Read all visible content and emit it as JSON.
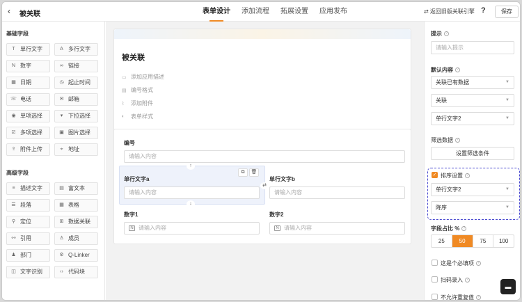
{
  "header": {
    "back_icon": "chevron-left-icon",
    "title": "被关联",
    "tabs": [
      {
        "label": "表单设计",
        "active": true
      },
      {
        "label": "添加流程",
        "active": false
      },
      {
        "label": "拓展设置",
        "active": false
      },
      {
        "label": "应用发布",
        "active": false
      }
    ],
    "engine_label": "⇄ 返回旧版关联引擎",
    "help": "?",
    "save_label": "保存"
  },
  "palette": {
    "basic_title": "基础字段",
    "basic": [
      {
        "icon": "T",
        "label": "单行文字"
      },
      {
        "icon": "A",
        "label": "多行文字"
      },
      {
        "icon": "N",
        "label": "数字"
      },
      {
        "icon": "∞",
        "label": "链接"
      },
      {
        "icon": "▦",
        "label": "日期"
      },
      {
        "icon": "◷",
        "label": "起止时间"
      },
      {
        "icon": "☏",
        "label": "电话"
      },
      {
        "icon": "✉",
        "label": "邮箱"
      },
      {
        "icon": "◉",
        "label": "单项选择"
      },
      {
        "icon": "▾",
        "label": "下拉选择"
      },
      {
        "icon": "☑",
        "label": "多项选择"
      },
      {
        "icon": "▣",
        "label": "图片选择"
      },
      {
        "icon": "⇪",
        "label": "附件上传"
      },
      {
        "icon": "⌖",
        "label": "地址"
      }
    ],
    "advanced_title": "高级字段",
    "advanced": [
      {
        "icon": "≡",
        "label": "描述文字"
      },
      {
        "icon": "▤",
        "label": "富文本"
      },
      {
        "icon": "☰",
        "label": "段落"
      },
      {
        "icon": "▦",
        "label": "表格"
      },
      {
        "icon": "⚲",
        "label": "定位"
      },
      {
        "icon": "⊞",
        "label": "数据关联"
      },
      {
        "icon": "⚯",
        "label": "引用"
      },
      {
        "icon": "♙",
        "label": "成员"
      },
      {
        "icon": "♟",
        "label": "部门"
      },
      {
        "icon": "⚙",
        "label": "Q-Linker"
      },
      {
        "icon": "◫",
        "label": "文字识别"
      },
      {
        "icon": "‹›",
        "label": "代码块"
      }
    ]
  },
  "form": {
    "title": "被关联",
    "meta": [
      {
        "icon": "▭",
        "label": "添加应用描述"
      },
      {
        "icon": "▤",
        "label": "编号格式"
      },
      {
        "icon": "⌇",
        "label": "添加附件"
      },
      {
        "icon": "◐",
        "label": "表单样式"
      }
    ],
    "fields": {
      "number_label": "编号",
      "number_placeholder": "请输入内容",
      "a_label": "单行文字a",
      "a_placeholder": "请输入内容",
      "b_label": "单行文字b",
      "b_placeholder": "请输入内容",
      "n1_label": "数字1",
      "n1_placeholder": "请输入内容",
      "n2_label": "数字2",
      "n2_placeholder": "请输入内容",
      "number_icon_text": "N"
    }
  },
  "props": {
    "hint_label": "提示",
    "hint_placeholder": "请输入提示",
    "default_label": "默认内容",
    "default_select": "关联已有数据",
    "relation_select": "关联",
    "field_select": "单行文字2",
    "filter_label": "筛选数据",
    "filter_button": "设置筛选条件",
    "sort_label": "排序设置",
    "sort_field": "单行文字2",
    "sort_order": "降序",
    "ratio_label": "字段占比 %",
    "ratio_options": [
      "25",
      "50",
      "75",
      "100"
    ],
    "ratio_selected": "50",
    "required_label": "这是个必填项",
    "scan_label": "扫码录入",
    "unique_label": "不允许重复值"
  },
  "colors": {
    "accent": "#f08a24",
    "selection": "#4a4ad0"
  }
}
